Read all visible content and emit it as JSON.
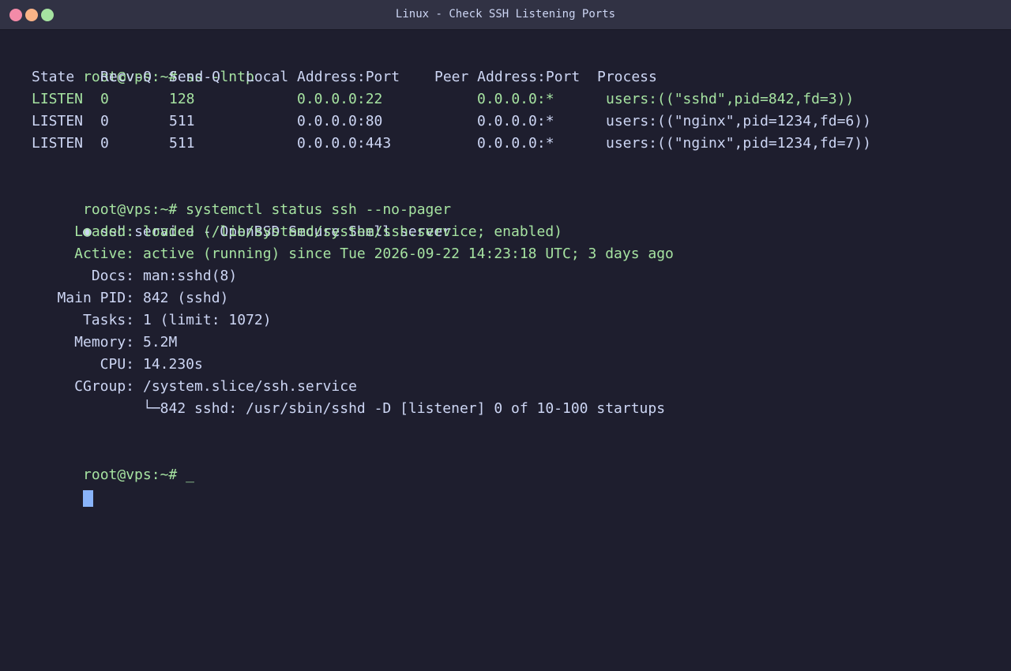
{
  "window": {
    "title": "Linux - Check SSH Listening Ports"
  },
  "colors": {
    "background": "#1e1e2e",
    "titlebar": "#313244",
    "text": "#cdd6f4",
    "green": "#a6e3a1",
    "cursor": "#89b4fa",
    "close": "#f38ba8",
    "minimize": "#fab387",
    "maximize": "#a6e3a1"
  },
  "session": {
    "prompt": "root@vps:~#",
    "cmd1": "ss -lntp",
    "ss_header": {
      "state": "State",
      "recvq": "Recv-Q",
      "sendq": "Send-Q",
      "local": "Local Address:Port",
      "peer": "Peer Address:Port",
      "process": "Process"
    },
    "ss_rows": [
      {
        "state": "LISTEN",
        "recvq": "0",
        "sendq": "128",
        "local": "0.0.0.0:22",
        "peer": "0.0.0.0:*",
        "process": "users:((\"sshd\",pid=842,fd=3))"
      },
      {
        "state": "LISTEN",
        "recvq": "0",
        "sendq": "511",
        "local": "0.0.0.0:80",
        "peer": "0.0.0.0:*",
        "process": "users:((\"nginx\",pid=1234,fd=6))"
      },
      {
        "state": "LISTEN",
        "recvq": "0",
        "sendq": "511",
        "local": "0.0.0.0:443",
        "peer": "0.0.0.0:*",
        "process": "users:((\"nginx\",pid=1234,fd=7))"
      }
    ],
    "cmd2": "systemctl status ssh --no-pager",
    "service_line": "ssh.service - OpenBSD Secure Shell server",
    "status": [
      {
        "label": "Loaded:",
        "value": "loaded (/lib/systemd/system/ssh.service; enabled)"
      },
      {
        "label": "Active:",
        "value": "active (running) since Tue 2026-09-22 14:23:18 UTC; 3 days ago"
      },
      {
        "label": "Docs:",
        "value": "man:sshd(8)"
      },
      {
        "label": "Main PID:",
        "value": "842 (sshd)"
      },
      {
        "label": "Tasks:",
        "value": "1 (limit: 1072)"
      },
      {
        "label": "Memory:",
        "value": "5.2M"
      },
      {
        "label": "CPU:",
        "value": "14.230s"
      },
      {
        "label": "CGroup:",
        "value": "/system.slice/ssh.service"
      }
    ],
    "cgroup_child": "└─842 sshd: /usr/sbin/sshd -D [listener] 0 of 10-100 startups",
    "final_input": "_"
  }
}
